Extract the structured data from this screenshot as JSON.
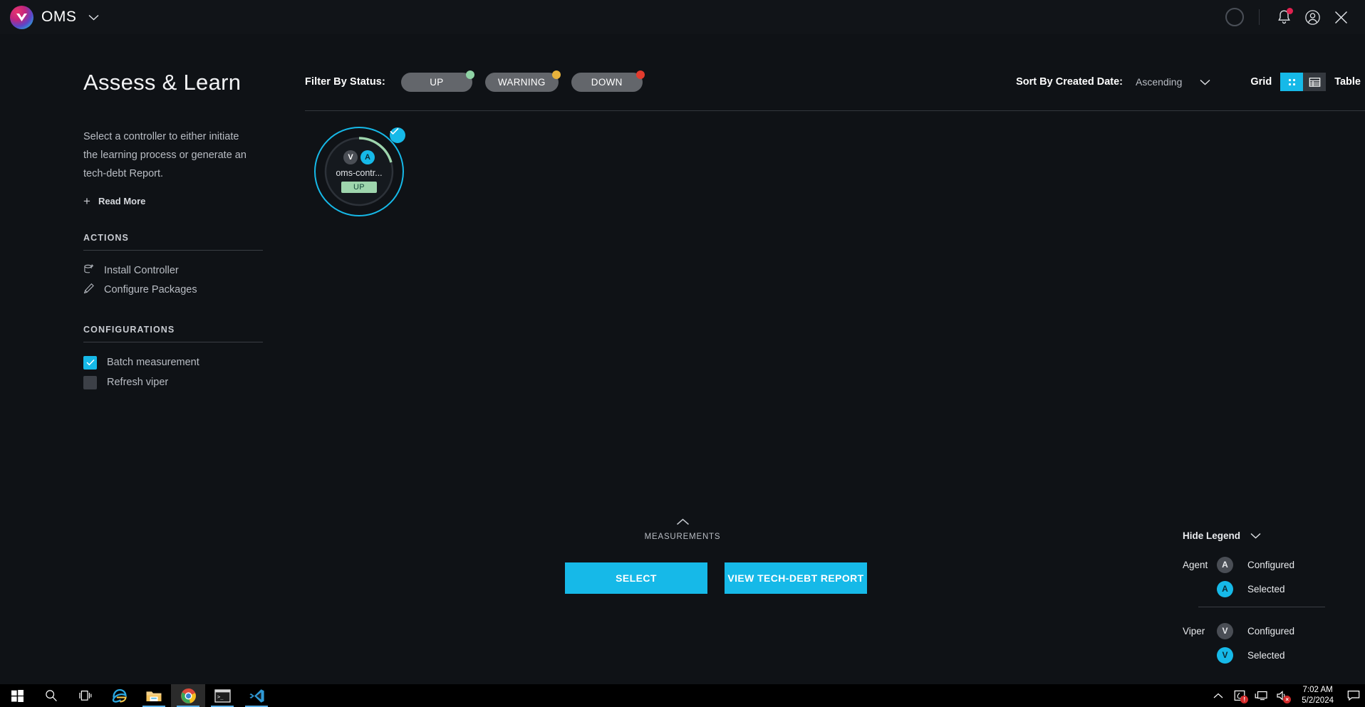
{
  "topbar": {
    "brand_name": "OMS",
    "icons": {
      "progress_ring": "progress-ring-icon",
      "bell": "bell-icon",
      "account": "account-icon",
      "close": "close-icon"
    }
  },
  "sidebar": {
    "title": "Assess & Learn",
    "description": "Select a controller to either initiate the learning process or generate an tech-debt Report.",
    "read_more": "Read More",
    "actions_heading": "ACTIONS",
    "actions": [
      {
        "label": "Install Controller",
        "icon": "install-container-icon"
      },
      {
        "label": "Configure Packages",
        "icon": "pencil-icon"
      }
    ],
    "configurations_heading": "CONFIGURATIONS",
    "configurations": [
      {
        "label": "Batch measurement",
        "checked": true
      },
      {
        "label": "Refresh viper",
        "checked": false
      }
    ]
  },
  "filterbar": {
    "label": "Filter By Status:",
    "statuses": [
      {
        "label": "UP",
        "color": "#8fd3a5"
      },
      {
        "label": "WARNING",
        "color": "#e8b33c"
      },
      {
        "label": "DOWN",
        "color": "#e23b2e"
      }
    ],
    "sort_label": "Sort By Created Date:",
    "sort_value": "Ascending",
    "view_grid_label": "Grid",
    "view_table_label": "Table",
    "active_view": "Grid"
  },
  "nodes": [
    {
      "name": "oms-contr...",
      "status": "UP",
      "selected": true,
      "badges": [
        {
          "letter": "V",
          "state": "configured"
        },
        {
          "letter": "A",
          "state": "selected"
        }
      ]
    }
  ],
  "bottom": {
    "measurements_label": "MEASUREMENTS",
    "select_button": "SELECT",
    "report_button": "VIEW TECH-DEBT REPORT"
  },
  "legend": {
    "toggle_label": "Hide Legend",
    "groups": [
      {
        "key": "Agent",
        "rows": [
          {
            "letter": "A",
            "state": "configured",
            "label": "Configured"
          },
          {
            "letter": "A",
            "state": "selected",
            "label": "Selected"
          }
        ]
      },
      {
        "key": "Viper",
        "rows": [
          {
            "letter": "V",
            "state": "configured",
            "label": "Configured"
          },
          {
            "letter": "V",
            "state": "selected",
            "label": "Selected"
          }
        ]
      }
    ]
  },
  "taskbar": {
    "items": [
      "start-icon",
      "search-icon",
      "task-view-icon",
      "internet-explorer-icon",
      "file-explorer-icon",
      "chrome-icon",
      "terminal-icon",
      "vscode-icon"
    ],
    "tray": {
      "chevron": "show-hidden-icons",
      "security_alert": "security-alert-icon",
      "network": "network-icon",
      "volume": "volume-muted-icon",
      "time": "7:02 AM",
      "date": "5/2/2024",
      "notifications": "action-center-icon"
    }
  },
  "colors": {
    "accent": "#16b9e8",
    "background": "#0f1216",
    "status_up": "#8fd3a5",
    "status_warning": "#e8b33c",
    "status_down": "#e23b2e",
    "badge_red": "#e0214f"
  }
}
